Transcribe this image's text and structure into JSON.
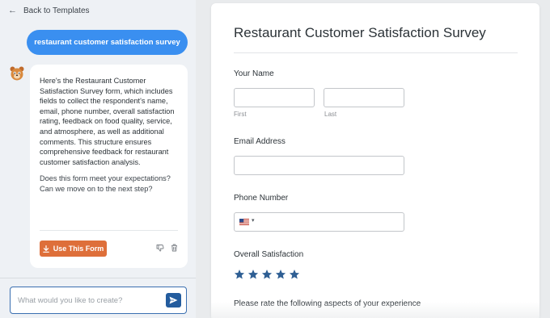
{
  "topbar": {
    "back_label": "Back to Templates"
  },
  "chat": {
    "user_message": "restaurant customer satisfaction survey",
    "ai_message": "Here's the Restaurant Customer Satisfaction Survey form, which includes fields to collect the respondent's name, email, phone number, overall satisfaction rating, feedback on food quality, service, and atmosphere, as well as additional comments. This structure ensures comprehensive feedback for restaurant customer satisfaction analysis.",
    "ai_question": "Does this form meet your expectations? Can we move on to the next step?",
    "use_form_label": "Use This Form",
    "input_placeholder": "What would you like to create?"
  },
  "form": {
    "title": "Restaurant Customer Satisfaction Survey",
    "name_label": "Your Name",
    "first_sublabel": "First",
    "last_sublabel": "Last",
    "email_label": "Email Address",
    "phone_label": "Phone Number",
    "phone_country": "us-flag-icon",
    "satisfaction_label": "Overall Satisfaction",
    "rating": {
      "max": 5,
      "icon": "star-icon",
      "color": "#2f5f94"
    },
    "aspects_label": "Please rate the following aspects of your experience"
  },
  "colors": {
    "accent_blue": "#3a8ff0",
    "button_orange": "#de6f3a",
    "send_blue": "#235c9e"
  }
}
